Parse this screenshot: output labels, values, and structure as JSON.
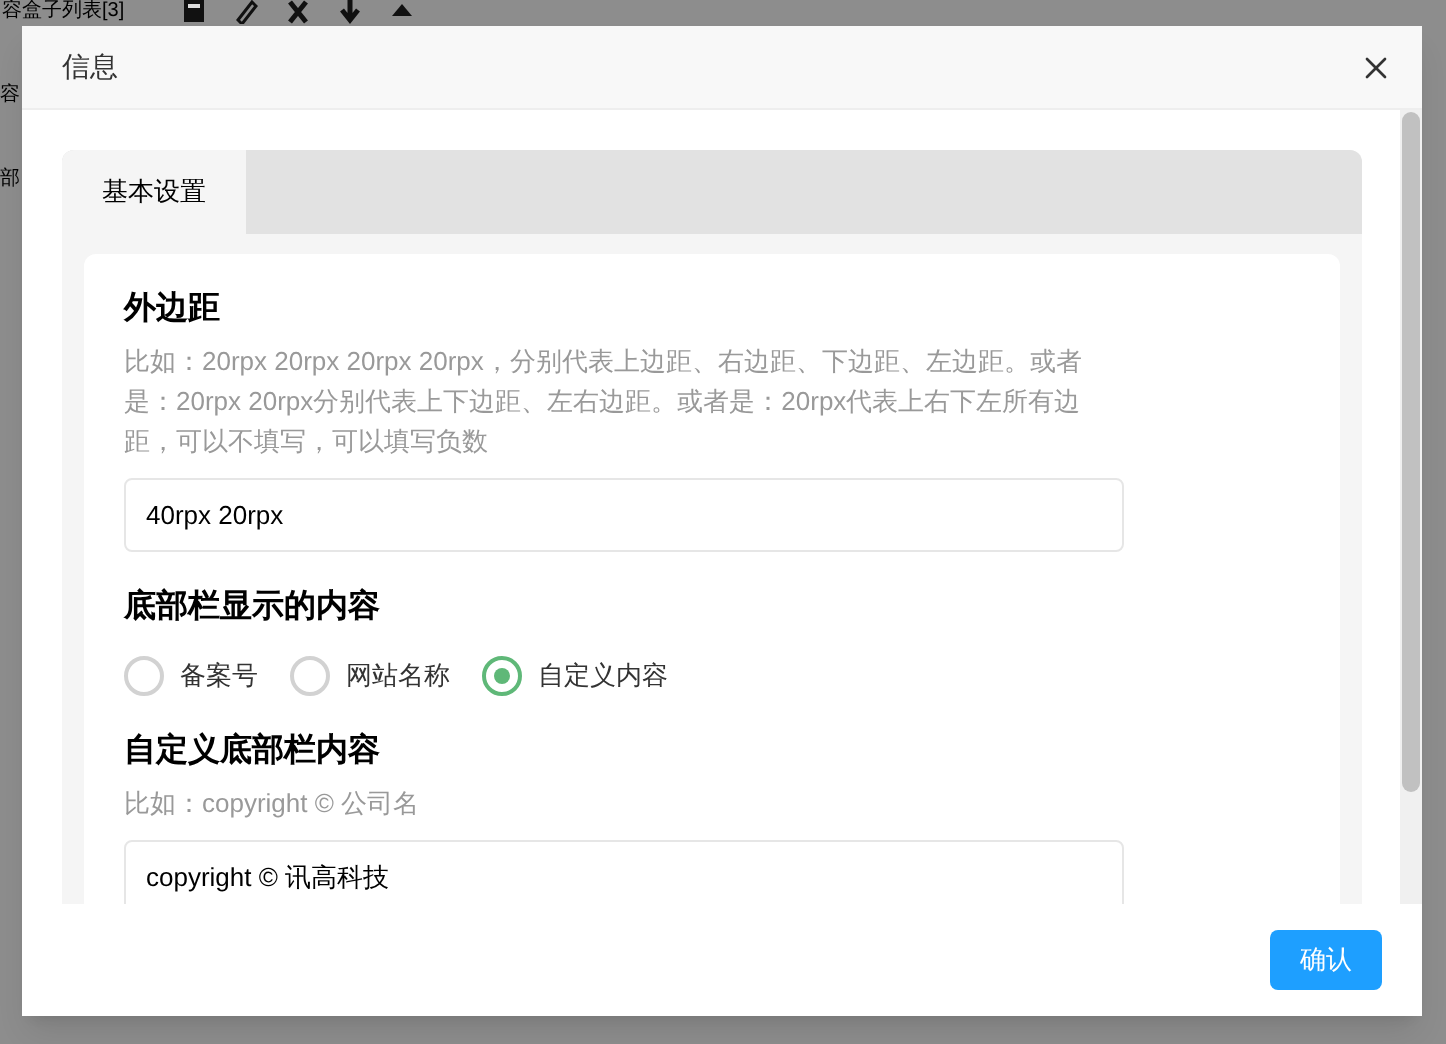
{
  "background": {
    "title": "容盒子列表[3]",
    "labels": [
      "容",
      "部"
    ]
  },
  "dialog": {
    "title": "信息",
    "tabs": [
      {
        "label": "基本设置",
        "selected": true
      }
    ],
    "fields": [
      {
        "kind": "text",
        "label": "外边距",
        "hint": "比如：20rpx 20rpx 20rpx 20rpx，分别代表上边距、右边距、下边距、左边距。或者是：20rpx 20rpx分别代表上下边距、左右边距。或者是：20rpx代表上右下左所有边距，可以不填写，可以填写负数",
        "value": "40rpx 20rpx"
      },
      {
        "kind": "radio",
        "label": "底部栏显示的内容",
        "options": [
          {
            "label": "备案号",
            "selected": false
          },
          {
            "label": "网站名称",
            "selected": false
          },
          {
            "label": "自定义内容",
            "selected": true
          }
        ]
      },
      {
        "kind": "text",
        "label": "自定义底部栏内容",
        "hint": "比如：copyright © 公司名",
        "value": "copyright © 讯高科技"
      }
    ],
    "buttons": [
      "确认"
    ]
  }
}
